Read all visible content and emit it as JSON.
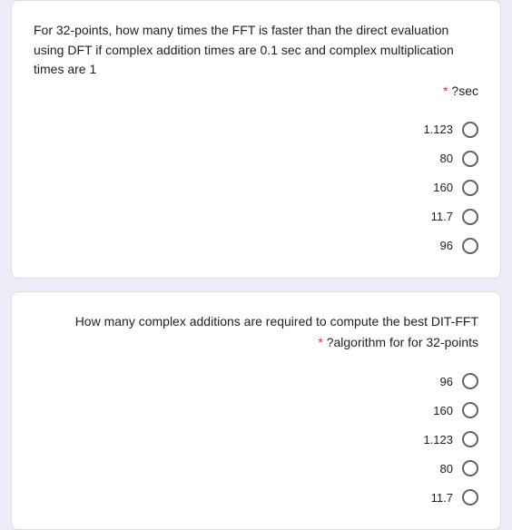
{
  "q1": {
    "text_line1": "For 32-points, how many times the FFT is faster than the direct evaluation using DFT if complex addition times are 0.1 sec and complex multiplication times are 1",
    "text_tail": "?sec",
    "options": [
      "1.123",
      "80",
      "160",
      "11.7",
      "96"
    ]
  },
  "q2": {
    "text_line1": "How many complex additions are required to compute the best DIT-FFT",
    "text_tail": "?algorithm for for 32-points",
    "options": [
      "96",
      "160",
      "1.123",
      "80",
      "11.7"
    ]
  }
}
